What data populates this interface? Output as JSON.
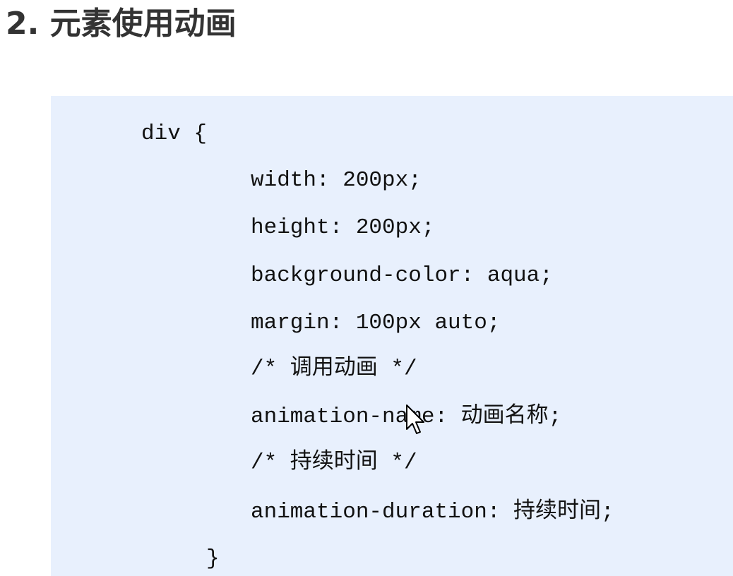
{
  "heading": "2. 元素使用动画",
  "code": {
    "lines": [
      "div {",
      "width: 200px;",
      "height: 200px;",
      "background-color: aqua;",
      "margin: 100px auto;",
      "/* 调用动画 */",
      "animation-name: 动画名称;",
      "/* 持续时间 */",
      "animation-duration: 持续时间;",
      "}"
    ]
  },
  "colors": {
    "heading_text": "#333333",
    "code_background": "#e8f0fd",
    "code_text": "#111111"
  },
  "icons": {
    "cursor": "mouse-pointer-icon"
  }
}
